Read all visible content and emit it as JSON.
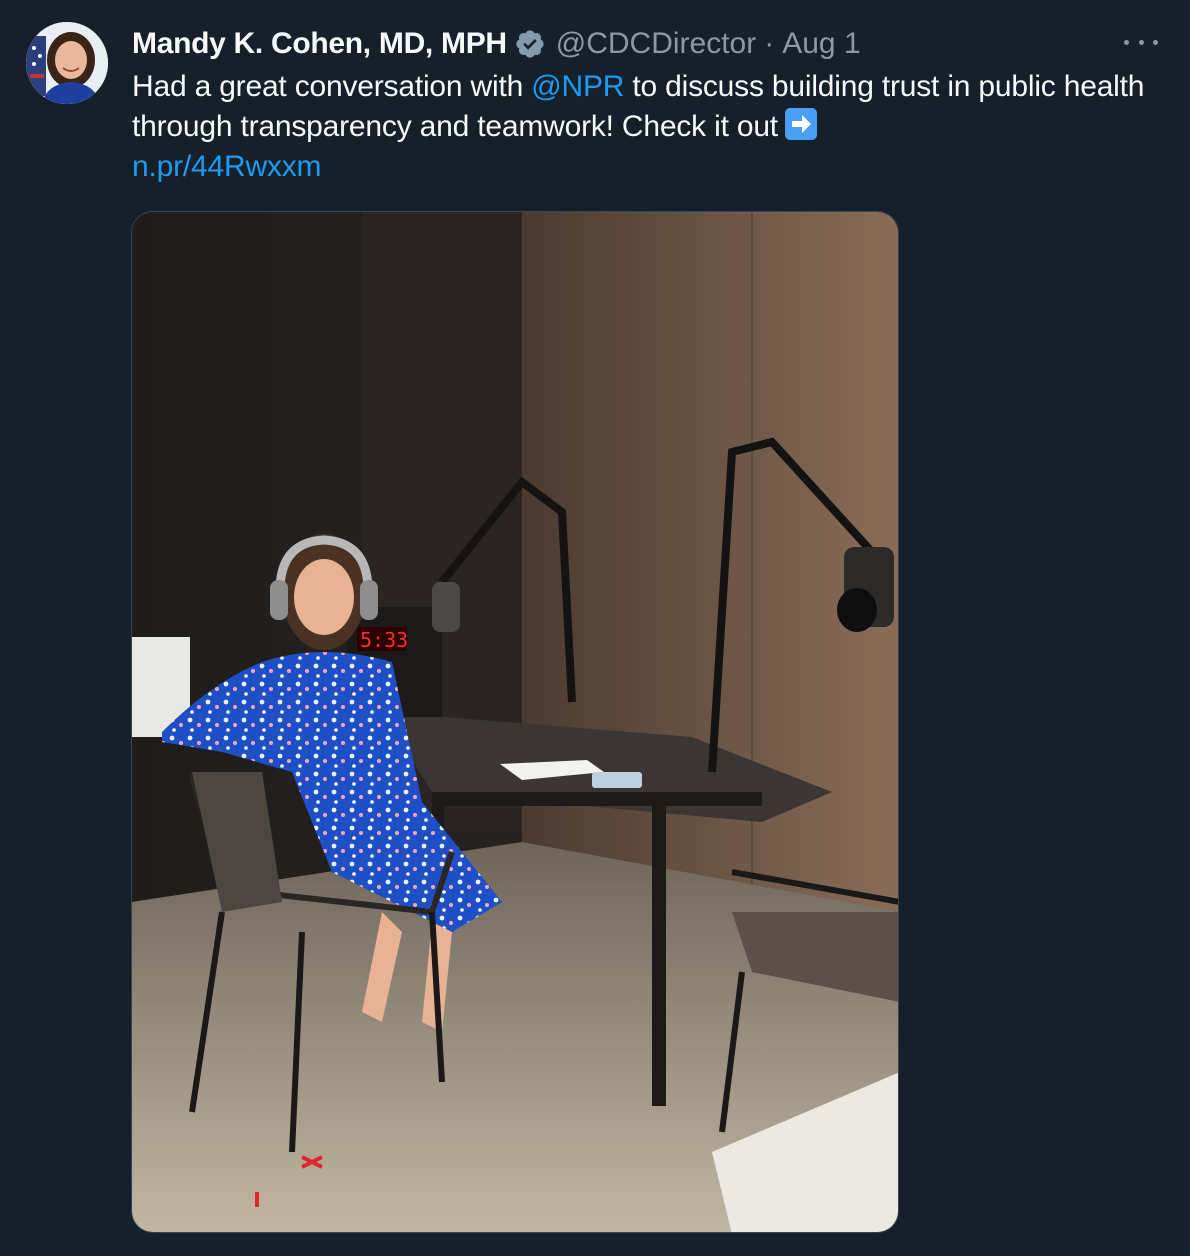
{
  "tweet": {
    "author_name": "Mandy K. Cohen, MD, MPH",
    "handle": "@CDCDirector",
    "separator": "·",
    "date": "Aug 1",
    "text_part1": "Had a great conversation with ",
    "mention": "@NPR",
    "text_part2": " to discuss building trust in public health through transparency and teamwork! Check it out",
    "link": "n.pr/44Rwxxm",
    "clock_display": "5:33"
  },
  "icons": {
    "avatar": "profile-photo",
    "verified": "verified-badge-icon",
    "more": "more-options-icon",
    "emoji": "right-arrow-emoji-icon"
  },
  "colors": {
    "background": "#15202b",
    "text": "#f7f9f9",
    "muted": "#8b98a5",
    "link": "#1d9bf0"
  }
}
